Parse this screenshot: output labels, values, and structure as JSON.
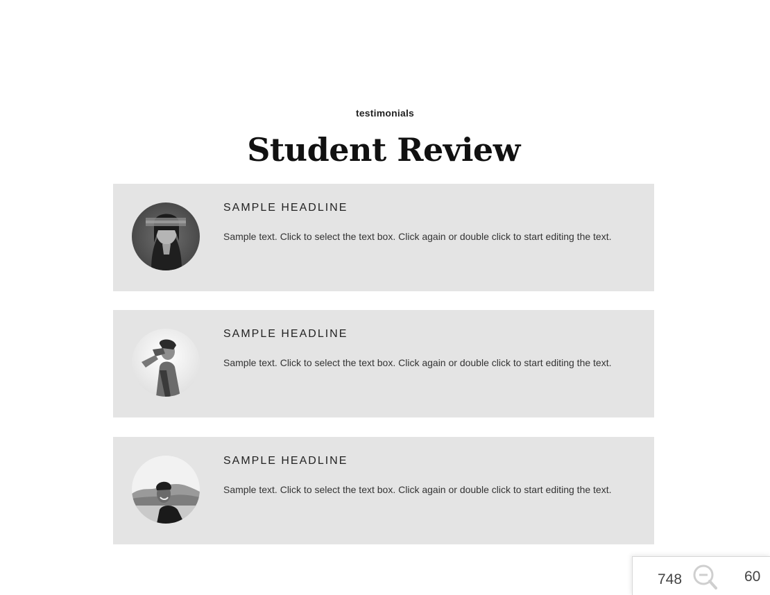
{
  "section": {
    "eyebrow": "testimonials",
    "title": "Student Review"
  },
  "reviews": [
    {
      "headline": "SAMPLE HEADLINE",
      "text": "Sample text. Click to select the text box. Click again or double click to start editing the text.",
      "avatar": "woman-portrait-photo"
    },
    {
      "headline": "SAMPLE HEADLINE",
      "text": "Sample text. Click to select the text box. Click again or double click to start editing the text.",
      "avatar": "person-hand-over-face-photo"
    },
    {
      "headline": "SAMPLE HEADLINE",
      "text": "Sample text. Click to select the text box. Click again or double click to start editing the text.",
      "avatar": "smiling-man-outdoors-photo"
    }
  ],
  "zoom": {
    "left_value": "748",
    "right_value": "60",
    "icon": "zoom-out-icon"
  },
  "colors": {
    "card_background": "#e4e4e4",
    "page_background": "#ffffff",
    "text_dark": "#111111"
  }
}
